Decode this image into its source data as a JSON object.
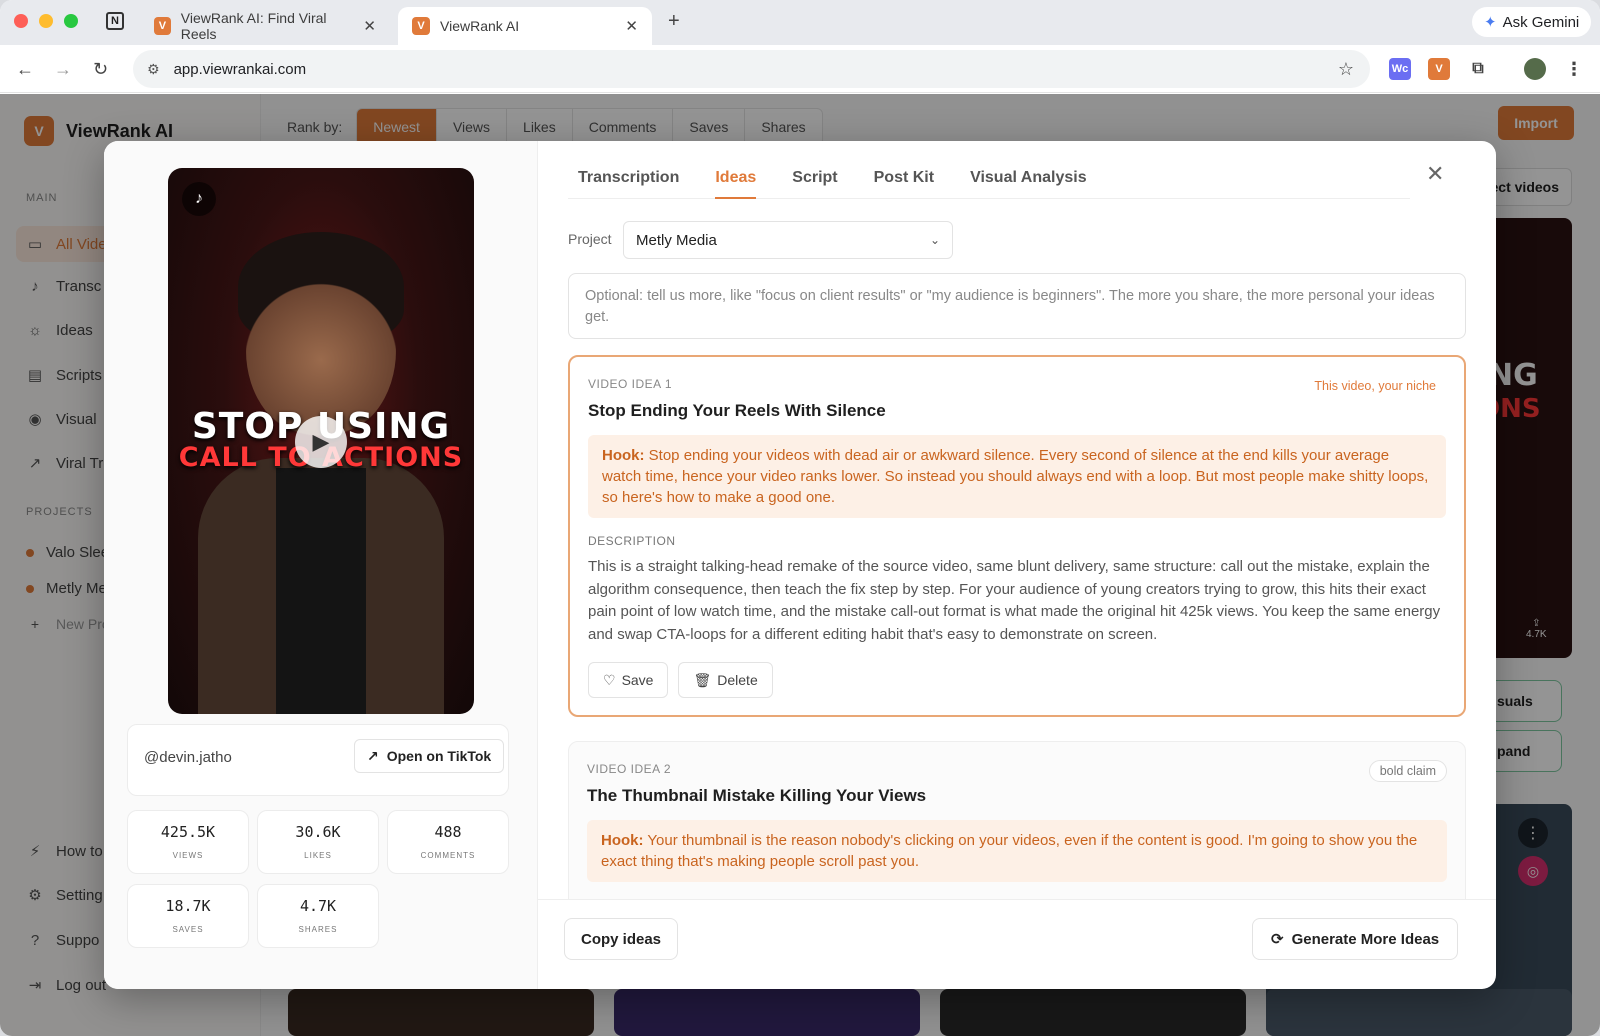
{
  "browser": {
    "tabs": [
      {
        "title": "ViewRank AI: Find Viral Reels"
      },
      {
        "title": "ViewRank AI"
      }
    ],
    "url": "app.viewrankai.com",
    "ask_gemini": "Ask Gemini"
  },
  "sidebar": {
    "brand": "ViewRank AI",
    "main_label": "MAIN",
    "items": [
      {
        "label": "All Vide"
      },
      {
        "label": "Transc"
      },
      {
        "label": "Ideas"
      },
      {
        "label": "Scripts"
      },
      {
        "label": "Visual"
      },
      {
        "label": "Viral Tr"
      }
    ],
    "projects_label": "PROJECTS",
    "projects": [
      {
        "label": "Valo Slee"
      },
      {
        "label": "Metly Me"
      }
    ],
    "new_project": "New Pro",
    "bottom": [
      {
        "label": "How to"
      },
      {
        "label": "Setting"
      },
      {
        "label": "Suppo"
      },
      {
        "label": "Log out"
      }
    ]
  },
  "rank": {
    "label": "Rank by:",
    "options": [
      "Newest",
      "Views",
      "Likes",
      "Comments",
      "Saves",
      "Shares"
    ],
    "selected": "Newest",
    "import": "Import",
    "select_videos": "ect videos",
    "bg_share_count": "4.7K",
    "bg_btn1": "suals",
    "bg_btn2": "pand"
  },
  "modal": {
    "video": {
      "overlay_line1": "STOP USING",
      "overlay_line2": "CALL TO ACTIONS"
    },
    "author": "@devin.jatho",
    "open_label": "Open on TikTok",
    "stats": [
      {
        "value": "425.5K",
        "label": "VIEWS"
      },
      {
        "value": "30.6K",
        "label": "LIKES"
      },
      {
        "value": "488",
        "label": "COMMENTS"
      },
      {
        "value": "18.7K",
        "label": "SAVES"
      },
      {
        "value": "4.7K",
        "label": "SHARES"
      }
    ],
    "tabs": [
      "Transcription",
      "Ideas",
      "Script",
      "Post Kit",
      "Visual Analysis"
    ],
    "active_tab": "Ideas",
    "project_label": "Project",
    "project_value": "Metly Media",
    "placeholder": "Optional: tell us more, like \"focus on client results\" or \"my audience is beginners\". The more you share, the more personal your ideas get.",
    "ideas": [
      {
        "label": "VIDEO IDEA 1",
        "tag": "This video, your niche",
        "title": "Stop Ending Your Reels With Silence",
        "hook_label": "Hook:",
        "hook": "Stop ending your videos with dead air or awkward silence. Every second of silence at the end kills your average watch time, hence your video ranks lower. So instead you should always end with a loop. But most people make shitty loops, so here's how to make a good one.",
        "desc_label": "DESCRIPTION",
        "desc": "This is a straight talking-head remake of the source video, same blunt delivery, same structure: call out the mistake, explain the algorithm consequence, then teach the fix step by step. For your audience of young creators trying to grow, this hits their exact pain point of low watch time, and the mistake call-out format is what made the original hit 425k views. You keep the same energy and swap CTA-loops for a different editing habit that's easy to demonstrate on screen.",
        "save": "Save",
        "delete": "Delete"
      },
      {
        "label": "VIDEO IDEA 2",
        "tag": "bold claim",
        "title": "The Thumbnail Mistake Killing Your Views",
        "hook_label": "Hook:",
        "hook": "Your thumbnail is the reason nobody's clicking on your videos, even if the content is good. I'm going to show you the exact thing that's making people scroll past you."
      }
    ],
    "copy_ideas": "Copy ideas",
    "generate_more": "Generate More Ideas"
  }
}
